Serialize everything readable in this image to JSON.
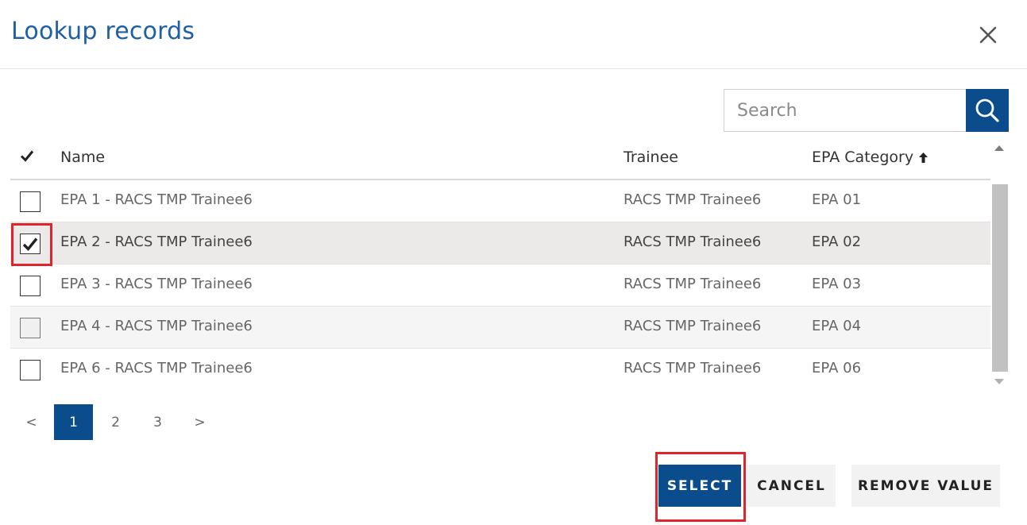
{
  "dialog": {
    "title": "Lookup records",
    "close_label": "×"
  },
  "search": {
    "placeholder": "Search",
    "value": ""
  },
  "table": {
    "columns": {
      "name": "Name",
      "trainee": "Trainee",
      "category": "EPA Category"
    },
    "sort_indicator": "ascending",
    "rows": [
      {
        "name": "EPA 1 - RACS TMP Trainee6",
        "trainee": "RACS TMP Trainee6",
        "category": "EPA 01",
        "checked": false
      },
      {
        "name": "EPA 2 - RACS TMP Trainee6",
        "trainee": "RACS TMP Trainee6",
        "category": "EPA 02",
        "checked": true
      },
      {
        "name": "EPA 3 - RACS TMP Trainee6",
        "trainee": "RACS TMP Trainee6",
        "category": "EPA 03",
        "checked": false
      },
      {
        "name": "EPA 4 - RACS TMP Trainee6",
        "trainee": "RACS TMP Trainee6",
        "category": "EPA 04",
        "checked": false
      },
      {
        "name": "EPA 6 - RACS TMP Trainee6",
        "trainee": "RACS TMP Trainee6",
        "category": "EPA 06",
        "checked": false
      }
    ]
  },
  "pagination": {
    "prev": "<",
    "pages": [
      "1",
      "2",
      "3"
    ],
    "current": "1",
    "next": ">"
  },
  "actions": {
    "select": "SELECT",
    "cancel": "CANCEL",
    "remove": "REMOVE VALUE"
  },
  "colors": {
    "accent": "#0b4d8c",
    "title": "#1f5fa6",
    "highlight": "#e0242b"
  },
  "icons": {
    "close": "close-icon",
    "search": "search-icon",
    "check": "checkmark-icon",
    "sort": "sort-up-arrow-icon"
  }
}
